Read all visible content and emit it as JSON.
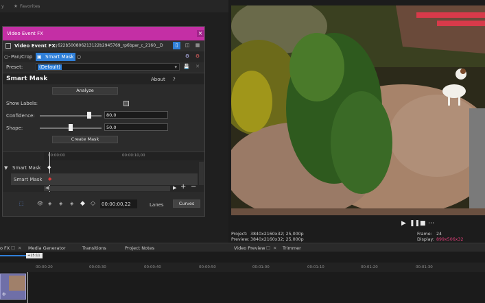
{
  "favorites": {
    "label": "Favorites"
  },
  "dialog": {
    "title": "Video Event FX",
    "fx_label": "Video Event FX:",
    "fx_file": "622b500806213122b2945769_rp6bpar_c_2160__D",
    "chain": {
      "item1": "Pan/Crop",
      "item2": "Smart Mask"
    },
    "preset_label": "Preset:",
    "preset_value": "(Default)",
    "plugin_name": "Smart Mask",
    "about_label": "About",
    "help_label": "?",
    "analyze_label": "Analyze",
    "show_labels_label": "Show Labels:",
    "confidence_label": "Confidence:",
    "confidence_value": "80,0",
    "confidence_fraction": 0.8,
    "shape_label": "Shape:",
    "shape_value": "50,0",
    "shape_fraction": 0.5,
    "create_mask_label": "Create Mask",
    "kf_times": {
      "t0": "00:00:00",
      "t1": "00:00:10,00"
    },
    "kf_tracks": [
      "Smart Mask",
      "Smart Mask"
    ],
    "kf_timecode": "00:00:00,22",
    "lanes_label": "Lanes",
    "curves_label": "Curves"
  },
  "preview": {
    "project_label": "Project:",
    "project_value": "3840x2160x32; 25,000p",
    "preview_label": "Preview:",
    "preview_value": "3840x2160x32; 25,000p",
    "frame_label": "Frame:",
    "frame_value": "24",
    "display_label": "Display:",
    "display_value": "899x506x32"
  },
  "tabs": {
    "fx": "o FX",
    "media_generator": "Media Generator",
    "transitions": "Transitions",
    "project_notes": "Project Notes",
    "video_preview": "Video Preview",
    "trimmer": "Trimmer"
  },
  "timeline": {
    "marker": "+15:11",
    "ticks": [
      "00:00:20",
      "00:00:30",
      "00:00:40",
      "00:00:50",
      "00:01:00",
      "00:01:10",
      "00:01:20",
      "00:01:30"
    ]
  },
  "colors": {
    "accent": "#c42fa5",
    "selection": "#2f7fd8",
    "display_value": "#e0407a"
  }
}
